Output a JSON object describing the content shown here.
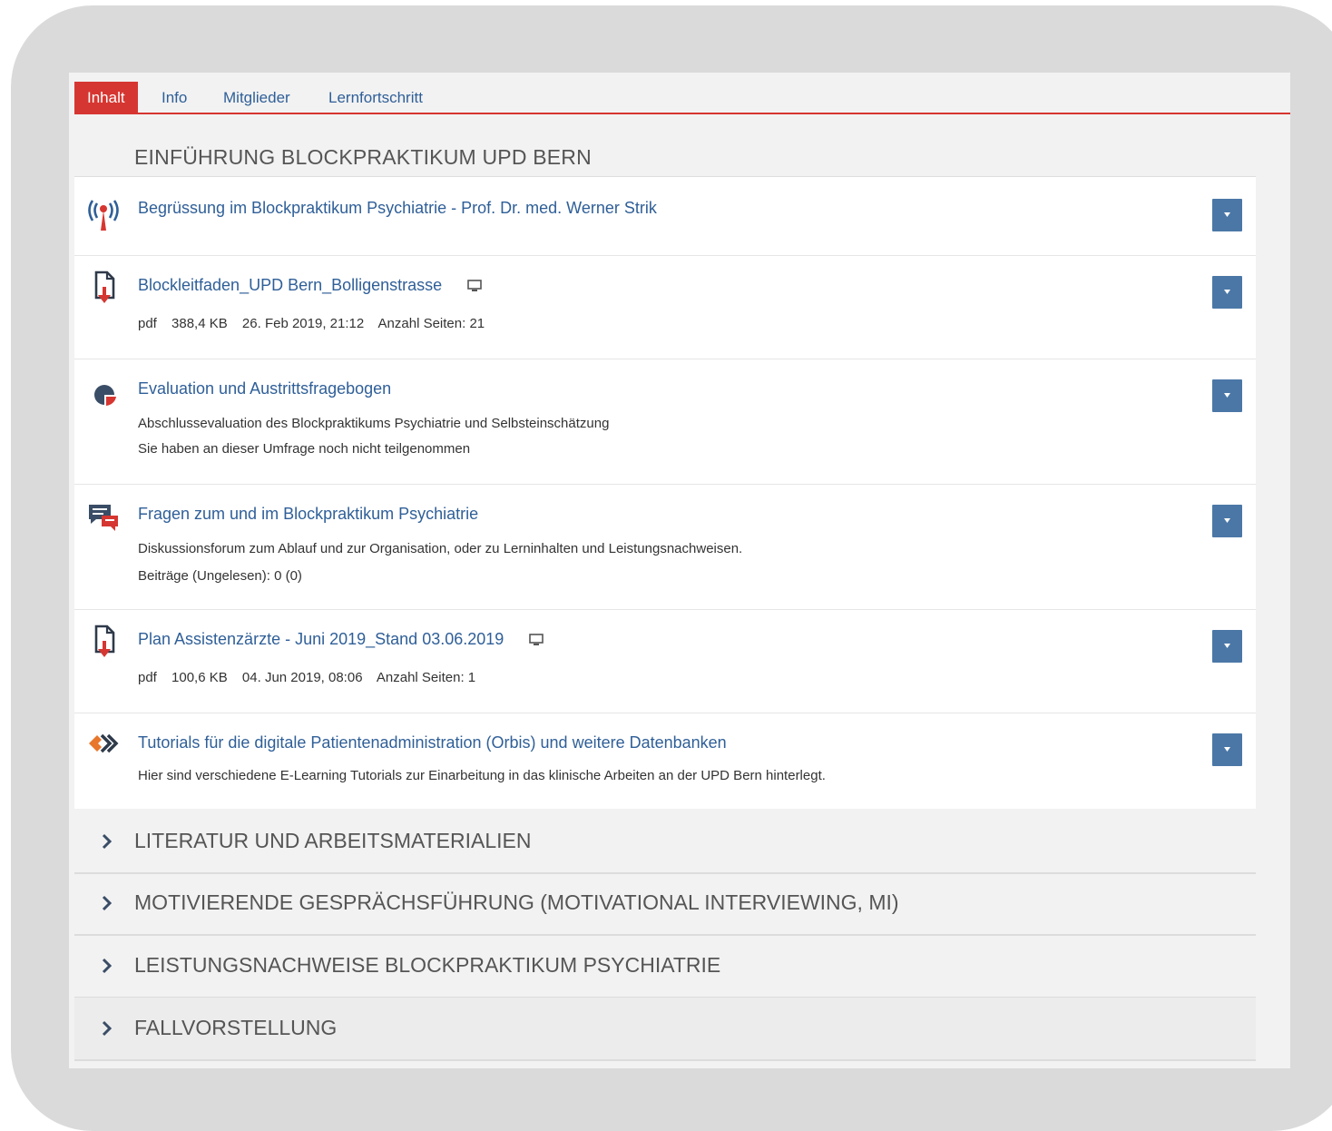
{
  "tabs": {
    "inhalt": "Inhalt",
    "info": "Info",
    "mitglieder": "Mitglieder",
    "lernfortschritt": "Lernfortschritt"
  },
  "section": {
    "title": "EINFÜHRUNG BLOCKPRAKTIKUM UPD BERN"
  },
  "items": [
    {
      "title": "Begrüssung im Blockpraktikum Psychiatrie - Prof. Dr. med. Werner Strik",
      "icon": "broadcast-icon"
    },
    {
      "title": "Blockleitfaden_UPD Bern_Bolligenstrasse",
      "icon": "file-download-icon",
      "meta": {
        "type": "pdf",
        "size": "388,4 KB",
        "date": "26. Feb 2019, 21:12",
        "pages": "Anzahl Seiten: 21"
      }
    },
    {
      "title": "Evaluation und Austrittsfragebogen",
      "icon": "survey-icon",
      "desc1": "Abschlussevaluation des Blockpraktikums Psychiatrie und Selbsteinschätzung",
      "desc2": "Sie haben an dieser Umfrage noch nicht teilgenommen"
    },
    {
      "title": "Fragen zum und im Blockpraktikum Psychiatrie",
      "icon": "forum-icon",
      "desc1": "Diskussionsforum zum Ablauf und zur Organisation, oder zu Lerninhalten und Leistungsnachweisen.",
      "desc2": "Beiträge (Ungelesen): 0 (0)"
    },
    {
      "title": "Plan Assistenzärzte - Juni 2019_Stand 03.06.2019",
      "icon": "file-download-icon",
      "meta": {
        "type": "pdf",
        "size": "100,6 KB",
        "date": "04. Jun 2019, 08:06",
        "pages": "Anzahl Seiten: 1"
      }
    },
    {
      "title": "Tutorials für die digitale Patientenadministration (Orbis) und weitere Datenbanken",
      "icon": "link-icon",
      "desc1": "Hier sind verschiedene E-Learning Tutorials zur Einarbeitung in das klinische Arbeiten an der UPD Bern hinterlegt."
    }
  ],
  "collapsed_sections": [
    "LITERATUR UND ARBEITSMATERIALIEN",
    "MOTIVIERENDE GESPRÄCHSFÜHRUNG (MOTIVATIONAL INTERVIEWING, MI)",
    "LEISTUNGSNACHWEISE BLOCKPRAKTIKUM PSYCHIATRIE",
    "FALLVORSTELLUNG"
  ],
  "colors": {
    "accent_red": "#d63631",
    "link_blue": "#2f5f98",
    "button_blue": "#4b77a7",
    "orange": "#e8762b"
  }
}
